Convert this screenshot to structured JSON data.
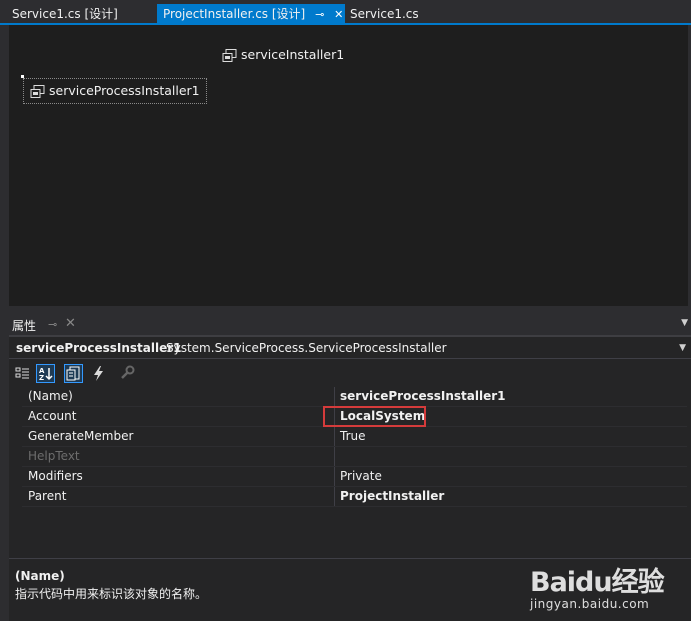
{
  "tabs": [
    {
      "label": "Service1.cs [设计]",
      "active": false
    },
    {
      "label": "ProjectInstaller.cs [设计]",
      "active": true
    },
    {
      "label": "Service1.cs",
      "active": false
    }
  ],
  "designer": {
    "components": [
      {
        "label": "serviceInstaller1",
        "selected": false
      },
      {
        "label": "serviceProcessInstaller1",
        "selected": true
      }
    ]
  },
  "properties": {
    "title": "属性",
    "object_name": "serviceProcessInstaller1",
    "object_type": "System.ServiceProcess.ServiceProcessInstaller",
    "rows": [
      {
        "name": "(Name)",
        "value": "serviceProcessInstaller1",
        "bold": true
      },
      {
        "name": "Account",
        "value": "LocalSystem",
        "bold": true
      },
      {
        "name": "GenerateMember",
        "value": "True",
        "bold": false
      },
      {
        "name": "HelpText",
        "value": "",
        "bold": false,
        "disabled": true
      },
      {
        "name": "Modifiers",
        "value": "Private",
        "bold": false
      },
      {
        "name": "Parent",
        "value": "ProjectInstaller",
        "bold": true
      }
    ],
    "description": {
      "title": "(Name)",
      "text": "指示代码中用来标识该对象的名称。"
    }
  },
  "watermark": {
    "brand": "Baidu经验",
    "url": "jingyan.baidu.com"
  },
  "colors": {
    "accent": "#007acc",
    "highlight": "#d43b3b"
  }
}
